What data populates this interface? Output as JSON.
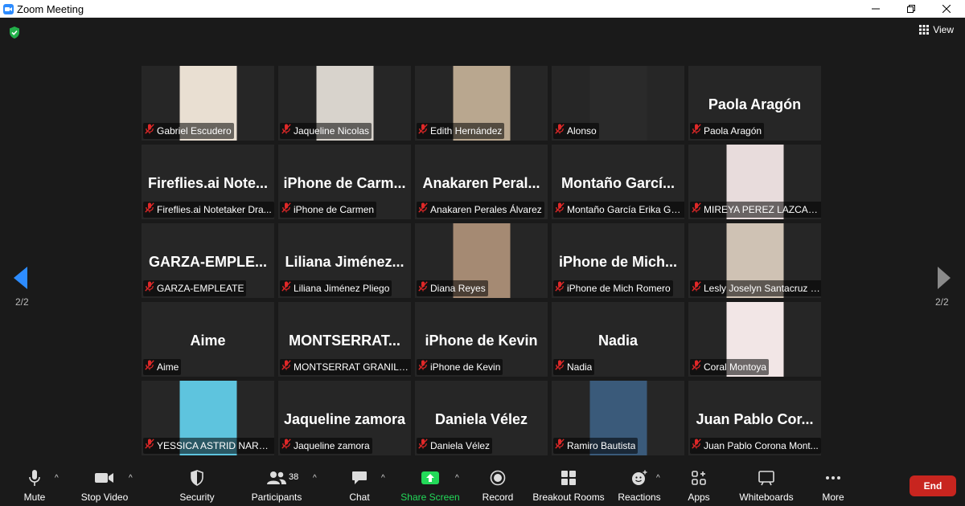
{
  "window": {
    "title": "Zoom Meeting"
  },
  "view": {
    "label": "View"
  },
  "pagination": {
    "left_page": "2/2",
    "right_page": "2/2"
  },
  "participants": [
    {
      "display": "",
      "name": "Gabriel Escudero",
      "video": true,
      "bg": "#e9dfd2"
    },
    {
      "display": "",
      "name": "Jaqueline Nicolas",
      "video": true,
      "bg": "#d8d3cc"
    },
    {
      "display": "",
      "name": "Edith Hernández",
      "video": true,
      "bg": "#b9a78f"
    },
    {
      "display": "",
      "name": "Alonso",
      "video": true,
      "bg": "#2a2a2a"
    },
    {
      "display": "Paola Aragón",
      "name": "Paola Aragón",
      "video": false
    },
    {
      "display": "Fireflies.ai  Note...",
      "name": "Fireflies.ai Notetaker Dra...",
      "video": false
    },
    {
      "display": "iPhone  de  Carm...",
      "name": "iPhone de Carmen",
      "video": false
    },
    {
      "display": "Anakaren  Peral...",
      "name": "Anakaren Perales Álvarez",
      "video": false
    },
    {
      "display": "Montaño  Garcí...",
      "name": "Montaño García Erika Gu...",
      "video": false
    },
    {
      "display": "",
      "name": "MIREYA PEREZ LAZCANO",
      "video": true,
      "bg": "#e8dcdc"
    },
    {
      "display": "GARZA-EMPLE...",
      "name": "GARZA-EMPLEATE",
      "video": false
    },
    {
      "display": "Liliana  Jiménez...",
      "name": "Liliana Jiménez Pliego",
      "video": false
    },
    {
      "display": "",
      "name": "Diana Reyes",
      "video": true,
      "bg": "#a58a73"
    },
    {
      "display": "iPhone  de  Mich...",
      "name": "iPhone de Mich Romero",
      "video": false
    },
    {
      "display": "",
      "name": "Lesly Joselyn Santacruz H...",
      "video": true,
      "bg": "#cfc2b4"
    },
    {
      "display": "Aime",
      "name": "Aime",
      "video": false
    },
    {
      "display": "MONTSERRAT...",
      "name": "MONTSERRAT GRANILLO",
      "video": false
    },
    {
      "display": "iPhone de Kevin",
      "name": "iPhone de Kevin",
      "video": false
    },
    {
      "display": "Nadia",
      "name": "Nadia",
      "video": false
    },
    {
      "display": "",
      "name": "Coral Montoya",
      "video": true,
      "bg": "#f2e6e6"
    },
    {
      "display": "",
      "name": "YESSICA ASTRID NARANJ...",
      "video": true,
      "bg": "#5ec4de"
    },
    {
      "display": "Jaqueline zamora",
      "name": "Jaqueline zamora",
      "video": false
    },
    {
      "display": "Daniela Vélez",
      "name": "Daniela Vélez",
      "video": false
    },
    {
      "display": "",
      "name": "Ramiro Bautista",
      "video": true,
      "bg": "#3a5a7a"
    },
    {
      "display": "Juan  Pablo  Cor...",
      "name": "Juan Pablo Corona Mont...",
      "video": false
    }
  ],
  "toolbar": {
    "mute": "Mute",
    "stop_video": "Stop Video",
    "security": "Security",
    "participants": "Participants",
    "participants_count": "38",
    "chat": "Chat",
    "share_screen": "Share Screen",
    "record": "Record",
    "breakout_rooms": "Breakout Rooms",
    "reactions": "Reactions",
    "apps": "Apps",
    "whiteboards": "Whiteboards",
    "more": "More",
    "end": "End"
  },
  "colors": {
    "share_green": "#23d959",
    "end_red": "#c8251f",
    "mute_red": "#e02828",
    "accent_blue": "#2d8cff"
  }
}
